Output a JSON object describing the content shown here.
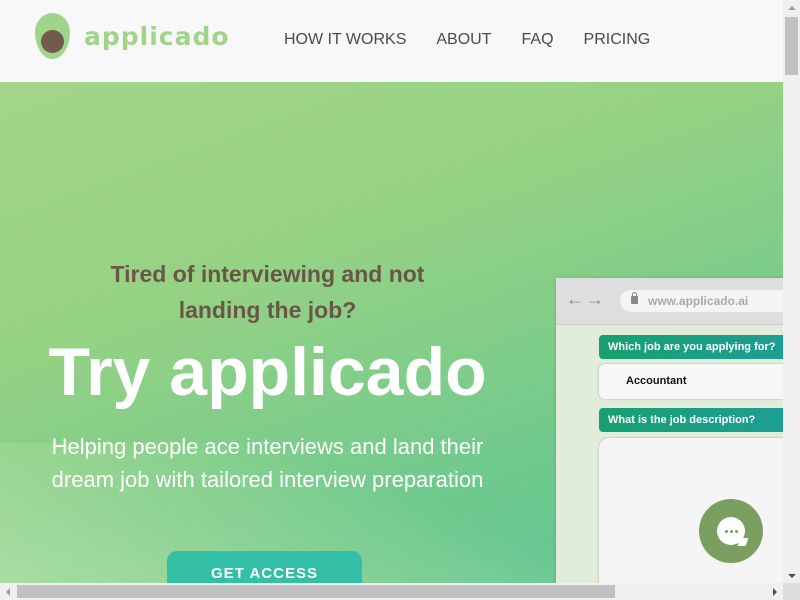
{
  "brand": {
    "name": "applicado",
    "logo_icon": "avocado-icon",
    "color": "#9fd489"
  },
  "nav": [
    {
      "label": "HOW IT WORKS"
    },
    {
      "label": "ABOUT"
    },
    {
      "label": "FAQ"
    },
    {
      "label": "PRICING"
    }
  ],
  "hero": {
    "tagline": "Tired of interviewing and not landing the job?",
    "title": "Try applicado",
    "subtitle": "Helping people ace interviews and land their dream job with tailored interview preparation",
    "cta_label": "GET ACCESS"
  },
  "mockup": {
    "url": "www.applicado.ai",
    "question1": "Which job are you applying for?",
    "answer1": "Accountant",
    "question2": "What is the job description?"
  },
  "chat_widget": {
    "icon": "chat-bubble-icon",
    "color": "#7a9f60"
  },
  "colors": {
    "accent": "#33bea6",
    "tagline": "#6b5548",
    "question_bg": "#17a070"
  }
}
